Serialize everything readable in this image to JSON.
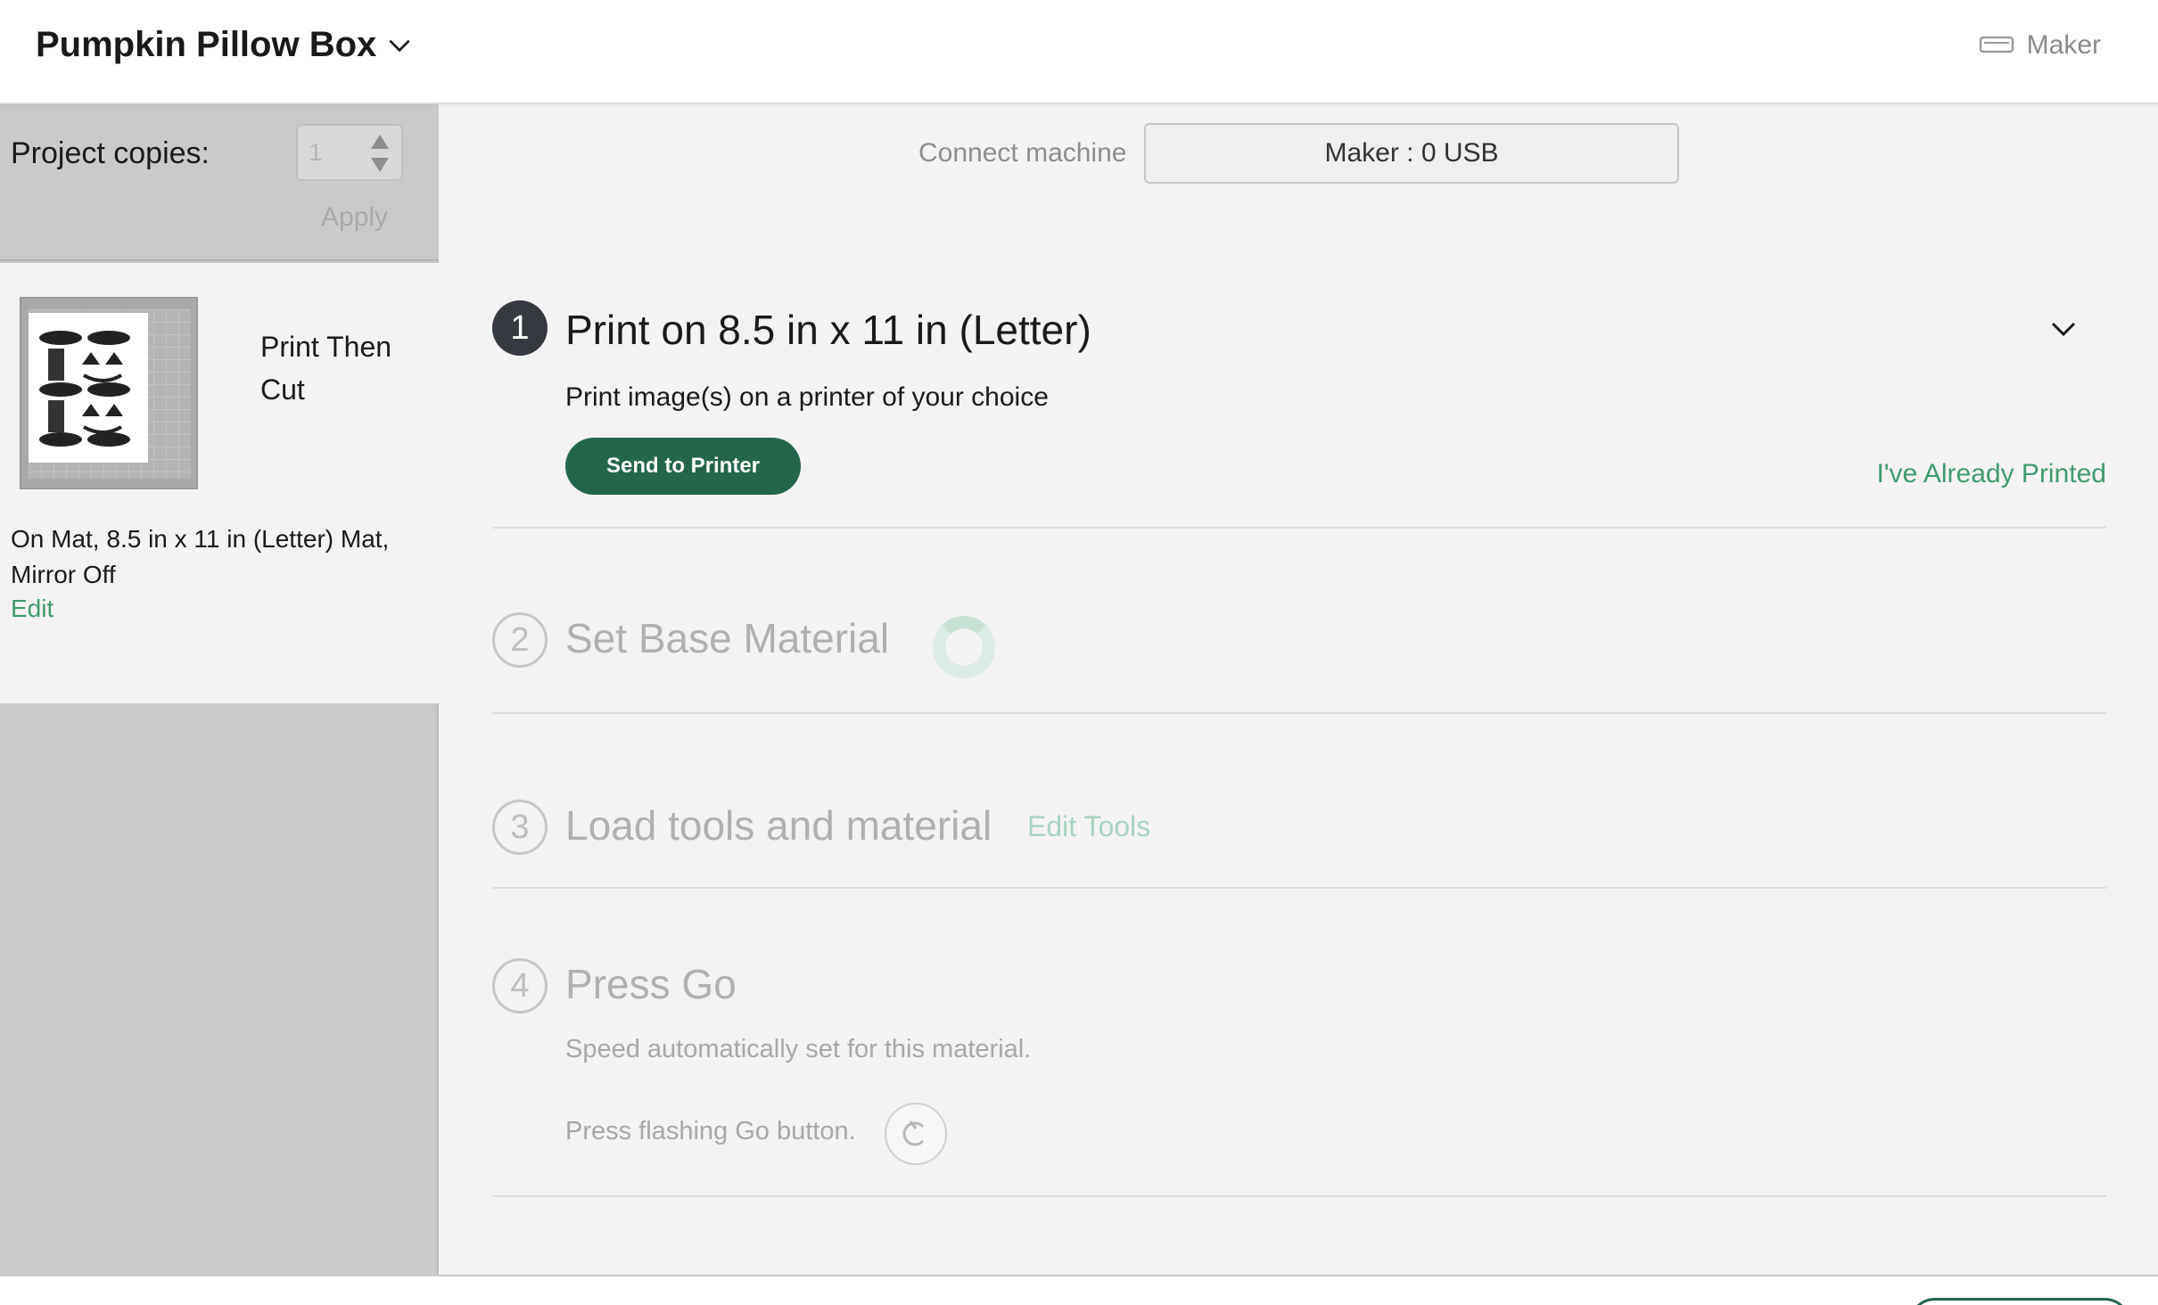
{
  "header": {
    "project_title": "Pumpkin Pillow Box",
    "machine_name": "Maker"
  },
  "sidebar": {
    "copies_label": "Project copies:",
    "copies_value": "1",
    "apply_label": "Apply",
    "mat": {
      "title": "Print Then Cut",
      "description": "On Mat, 8.5 in x 11 in (Letter) Mat, Mirror Off",
      "edit_label": "Edit"
    }
  },
  "main": {
    "connect_label": "Connect machine",
    "connect_value": "Maker : 0 USB",
    "steps": [
      {
        "number": "1",
        "title": "Print on 8.5 in x 11 in (Letter)",
        "subtitle": "Print image(s) on a printer of your choice",
        "primary_button": "Send to Printer",
        "secondary_link": "I've Already Printed"
      },
      {
        "number": "2",
        "title": "Set Base Material"
      },
      {
        "number": "3",
        "title": "Load tools and material",
        "link": "Edit Tools"
      },
      {
        "number": "4",
        "title": "Press Go",
        "speed_text": "Speed automatically set for this material.",
        "press_text": "Press flashing Go button."
      }
    ]
  },
  "colors": {
    "accent_green": "#24664b",
    "link_green": "#3f9b6e",
    "active_step": "#343a40"
  },
  "icons": [
    "chevron-down-icon",
    "machine-icon",
    "go-button-icon",
    "loading-spinner"
  ]
}
